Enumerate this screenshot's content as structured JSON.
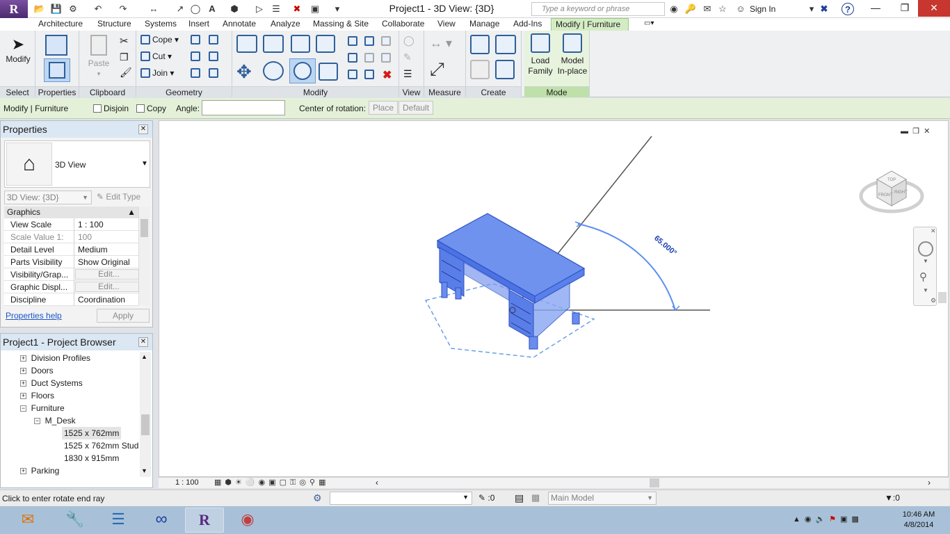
{
  "app": {
    "title": "Project1 - 3D View: {3D}",
    "logo_letter": "R"
  },
  "search": {
    "placeholder": "Type a keyword or phrase"
  },
  "account": {
    "sign_in": "Sign In"
  },
  "tabs": [
    "Architecture",
    "Structure",
    "Systems",
    "Insert",
    "Annotate",
    "Analyze",
    "Massing & Site",
    "Collaborate",
    "View",
    "Manage",
    "Add-Ins",
    "Modify | Furniture"
  ],
  "ribbon": {
    "select": {
      "modify": "Modify",
      "label": "Select"
    },
    "properties": {
      "label": "Properties"
    },
    "clipboard": {
      "paste": "Paste",
      "label": "Clipboard"
    },
    "geometry": {
      "cope": "Cope",
      "cut": "Cut",
      "join": "Join",
      "label": "Geometry"
    },
    "modify": {
      "label": "Modify"
    },
    "view": {
      "label": "View"
    },
    "measure": {
      "label": "Measure"
    },
    "create": {
      "label": "Create"
    },
    "mode": {
      "load": "Load",
      "family": "Family",
      "model": "Model",
      "inplace": "In-place",
      "label": "Mode"
    }
  },
  "options": {
    "context": "Modify | Furniture",
    "disjoin": "Disjoin",
    "copy": "Copy",
    "angle_label": "Angle:",
    "angle_value": "",
    "center_label": "Center of rotation:",
    "place": "Place",
    "default": "Default"
  },
  "properties": {
    "title": "Properties",
    "type_name": "3D View",
    "instance": "3D View: {3D}",
    "edit_type": "Edit Type",
    "group": "Graphics",
    "rows": [
      {
        "k": "View Scale",
        "v": "1 : 100"
      },
      {
        "k": "Scale Value    1:",
        "v": "100"
      },
      {
        "k": "Detail Level",
        "v": "Medium"
      },
      {
        "k": "Parts Visibility",
        "v": "Show Original"
      },
      {
        "k": "Visibility/Grap...",
        "v": "Edit..."
      },
      {
        "k": "Graphic Displ...",
        "v": "Edit..."
      },
      {
        "k": "Discipline",
        "v": "Coordination"
      }
    ],
    "help": "Properties help",
    "apply": "Apply"
  },
  "browser": {
    "title": "Project1 - Project Browser",
    "items": [
      {
        "label": "Division Profiles",
        "level": 1,
        "exp": "+"
      },
      {
        "label": "Doors",
        "level": 1,
        "exp": "+"
      },
      {
        "label": "Duct Systems",
        "level": 1,
        "exp": "+"
      },
      {
        "label": "Floors",
        "level": 1,
        "exp": "+"
      },
      {
        "label": "Furniture",
        "level": 1,
        "exp": "−"
      },
      {
        "label": "M_Desk",
        "level": 2,
        "exp": "−"
      },
      {
        "label": "1525 x 762mm",
        "level": 3,
        "exp": ""
      },
      {
        "label": "1525 x 762mm Stud",
        "level": 3,
        "exp": ""
      },
      {
        "label": "1830 x 915mm",
        "level": 3,
        "exp": ""
      },
      {
        "label": "Parking",
        "level": 1,
        "exp": "+"
      }
    ]
  },
  "viewport": {
    "angle_text": "65.000°",
    "scale": "1 : 100",
    "cube_front": "FRONT",
    "cube_right": "RIGHT",
    "cube_top": "TOP"
  },
  "status": {
    "message": "Click to enter rotate end ray",
    "count1": ":0",
    "model": "Main Model",
    "count2": ":0"
  },
  "clock": {
    "time": "10:46 AM",
    "date": "4/8/2014"
  },
  "colors": {
    "accent_green": "#bfe0a8",
    "selection_blue": "#3b6ee6",
    "close_red": "#c7372f"
  }
}
